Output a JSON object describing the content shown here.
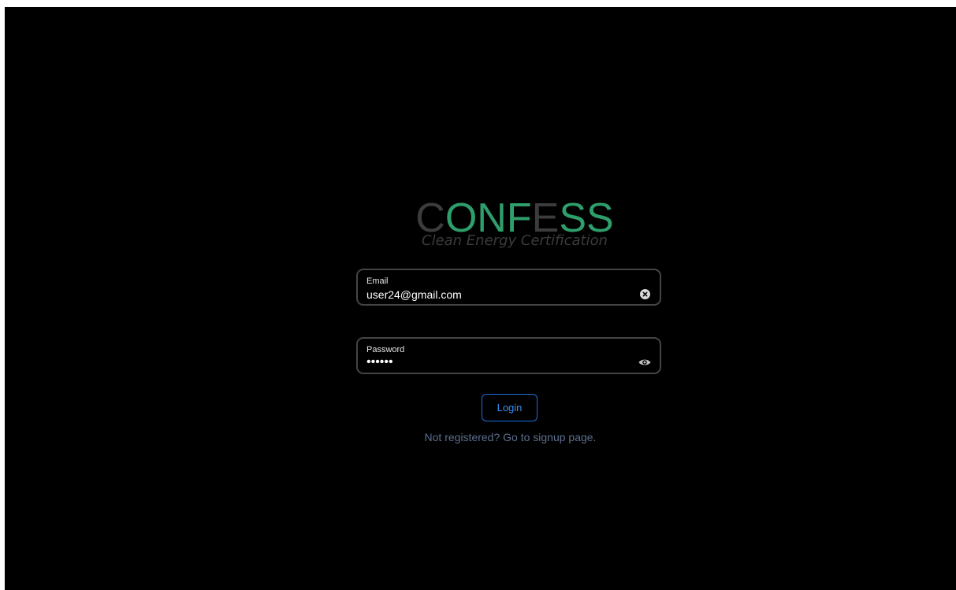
{
  "logo": {
    "letters": [
      "C",
      "ONF",
      "E",
      "SS"
    ],
    "colors": {
      "dim": "#3c3c3c",
      "accent": "#2e9e6b"
    }
  },
  "tagline": "Clean Energy Certification",
  "form": {
    "email": {
      "label": "Email",
      "value": "user24@gmail.com",
      "action_icon": "clear-icon"
    },
    "password": {
      "label": "Password",
      "masked_value": "••••••",
      "action_icon": "eye-icon"
    },
    "login_label": "Login",
    "signup_link": "Not registered? Go to signup page."
  },
  "colors": {
    "background": "#000000",
    "field_border": "#444444",
    "button_border": "#1e6fd9",
    "button_text": "#3a8ef6",
    "link_text": "#5d6f8e"
  }
}
